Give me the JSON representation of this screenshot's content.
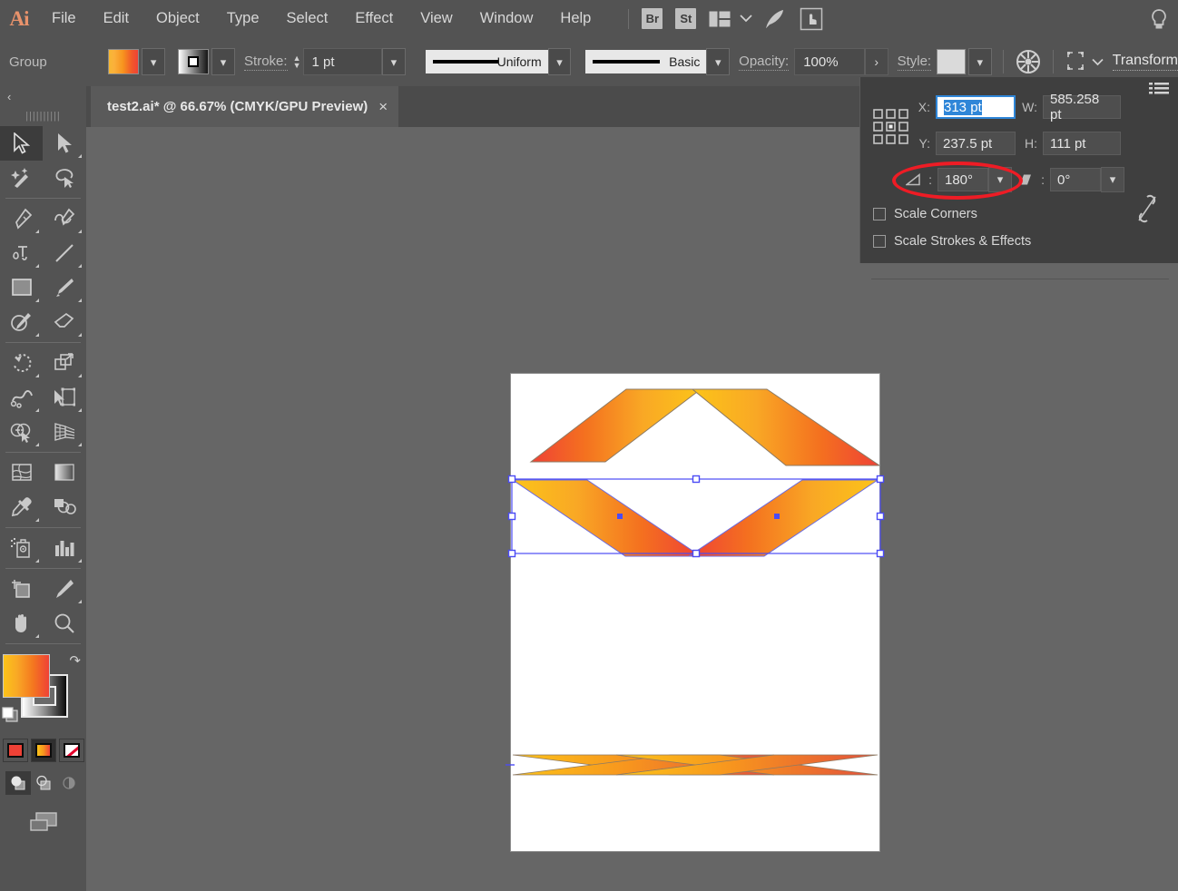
{
  "app": {
    "name": "Ai",
    "logo_color": "#e8926b"
  },
  "menubar": {
    "items": [
      "File",
      "Edit",
      "Object",
      "Type",
      "Select",
      "Effect",
      "View",
      "Window",
      "Help"
    ],
    "badges": [
      "Br",
      "St"
    ],
    "icons": [
      "arrange-documents-icon",
      "chevron-down-icon",
      "stock-icon",
      "touch-workspace-icon",
      "search-icon"
    ]
  },
  "controlbar": {
    "selection_type": "Group",
    "fill_label": "fill-swatch",
    "stroke_swatch_label": "stroke-swatch",
    "stroke_label": "Stroke:",
    "stroke_weight": "1 pt",
    "variable_width_profile": "Uniform",
    "brush_definition": "Basic",
    "opacity_label": "Opacity:",
    "opacity_value": "100%",
    "style_label": "Style:",
    "transform_label": "Transform",
    "icons": [
      "recolor-artwork-icon",
      "align-icon",
      "chevron-down-icon"
    ]
  },
  "tab": {
    "title": "test2.ai* @ 66.67% (CMYK/GPU Preview)",
    "close": "×"
  },
  "toolbar": {
    "collapse": "‹",
    "tools": [
      {
        "name": "selection-tool",
        "active": true,
        "corner": false
      },
      {
        "name": "direct-selection-tool",
        "active": false,
        "corner": true
      },
      {
        "name": "magic-wand-tool",
        "active": false,
        "corner": false
      },
      {
        "name": "lasso-tool",
        "active": false,
        "corner": false
      },
      {
        "name": "pen-tool",
        "active": false,
        "corner": true
      },
      {
        "name": "curvature-tool",
        "active": false,
        "corner": true
      },
      {
        "name": "type-tool",
        "active": false,
        "corner": true
      },
      {
        "name": "line-segment-tool",
        "active": false,
        "corner": true
      },
      {
        "name": "rectangle-tool",
        "active": false,
        "corner": true
      },
      {
        "name": "paintbrush-tool",
        "active": false,
        "corner": true
      },
      {
        "name": "shaper-tool",
        "active": false,
        "corner": true
      },
      {
        "name": "eraser-tool",
        "active": false,
        "corner": true
      },
      {
        "name": "rotate-tool",
        "active": false,
        "corner": true
      },
      {
        "name": "scale-tool",
        "active": false,
        "corner": true
      },
      {
        "name": "width-tool",
        "active": false,
        "corner": true
      },
      {
        "name": "free-transform-tool",
        "active": false,
        "corner": true
      },
      {
        "name": "shape-builder-tool",
        "active": false,
        "corner": true
      },
      {
        "name": "perspective-grid-tool",
        "active": false,
        "corner": true
      },
      {
        "name": "mesh-tool",
        "active": false,
        "corner": false
      },
      {
        "name": "gradient-tool",
        "active": false,
        "corner": false
      },
      {
        "name": "eyedropper-tool",
        "active": false,
        "corner": true
      },
      {
        "name": "blend-tool",
        "active": false,
        "corner": false
      },
      {
        "name": "symbol-sprayer-tool",
        "active": false,
        "corner": true
      },
      {
        "name": "column-graph-tool",
        "active": false,
        "corner": true
      },
      {
        "name": "artboard-tool",
        "active": false,
        "corner": false
      },
      {
        "name": "slice-tool",
        "active": false,
        "corner": true
      },
      {
        "name": "hand-tool",
        "active": false,
        "corner": true
      },
      {
        "name": "zoom-tool",
        "active": false,
        "corner": false
      }
    ],
    "color_controls": {
      "fill_name": "fill-color-swatch",
      "stroke_name": "stroke-color-swatch",
      "swap_icon": "swap-fill-stroke-icon",
      "default_icon": "default-fill-stroke-icon"
    },
    "fill_modes": [
      {
        "name": "color-button",
        "selected": false
      },
      {
        "name": "gradient-button",
        "selected": true
      },
      {
        "name": "none-button",
        "selected": false
      }
    ],
    "draw_modes": [
      {
        "name": "draw-normal-button",
        "selected": true
      },
      {
        "name": "draw-behind-button",
        "selected": false
      },
      {
        "name": "draw-inside-button",
        "selected": false
      }
    ],
    "screen_mode": "change-screen-mode-button"
  },
  "transform_panel": {
    "menu_icon": "panel-menu-icon",
    "reference_point": "reference-point-center",
    "x_label": "X:",
    "x_value": "313 pt",
    "y_label": "Y:",
    "y_value": "237.5 pt",
    "w_label": "W:",
    "w_value": "585.258 pt",
    "h_label": "H:",
    "h_value": "111 pt",
    "rotate_icon": "rotate-angle-icon",
    "rotate_value": "180°",
    "shear_icon": "shear-angle-icon",
    "shear_value": "0°",
    "chain_icon": "constrain-proportions-icon",
    "scale_corners_label": "Scale Corners",
    "scale_strokes_label": "Scale Strokes & Effects",
    "annotation": "red-ellipse-highlight-on-rotate-field"
  },
  "artwork": {
    "gradient_start": "#fcc419",
    "gradient_mid": "#f7941e",
    "gradient_end": "#ef4136",
    "selection_color": "#4b4bf5",
    "artboard_bg": "#ffffff",
    "canvas_bg": "#666666"
  }
}
